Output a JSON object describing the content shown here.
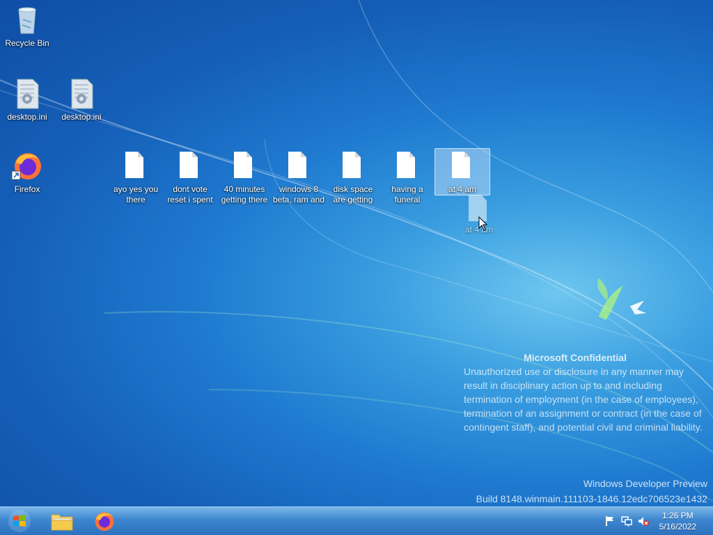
{
  "desktop": {
    "icons": [
      {
        "label": "Recycle Bin",
        "icon": "recycle-bin-icon"
      },
      {
        "label": "desktop.ini",
        "icon": "settings-file-icon"
      },
      {
        "label": "desktop.ini",
        "icon": "settings-file-icon"
      },
      {
        "label": "Firefox",
        "icon": "firefox-icon"
      },
      {
        "label": "ayo yes you there",
        "icon": "text-file-icon"
      },
      {
        "label": "dont vote reset i spent",
        "icon": "text-file-icon"
      },
      {
        "label": "40 minutes getting there",
        "icon": "text-file-icon"
      },
      {
        "label": "windows 8 beta, ram and",
        "icon": "text-file-icon"
      },
      {
        "label": "disk space are getting",
        "icon": "text-file-icon"
      },
      {
        "label": "having a funeral",
        "icon": "text-file-icon"
      },
      {
        "label": "at 4 am",
        "icon": "text-file-icon",
        "selected": true
      }
    ],
    "drag_ghost": {
      "label": "at 4 am"
    }
  },
  "watermark": {
    "title": "Microsoft Confidential",
    "body": "Unauthorized use or disclosure in any manner may result in disciplinary action up to and including termination of employment (in the case of employees), termination of an assignment or contract (in the case of contingent staff), and potential civil and criminal liability."
  },
  "build": {
    "line1": "Windows Developer Preview",
    "line2": "Build 8148.winmain.111103-1846.12edc706523e1432"
  },
  "taskbar": {
    "pinned": [
      {
        "icon": "start-orb-icon"
      },
      {
        "icon": "file-explorer-icon"
      },
      {
        "icon": "firefox-icon"
      }
    ],
    "clock": {
      "time": "1:26 PM",
      "date": "5/16/2022"
    }
  },
  "colors": {
    "accent": "#1f7bd0",
    "taskbar": "#3d86cf"
  }
}
